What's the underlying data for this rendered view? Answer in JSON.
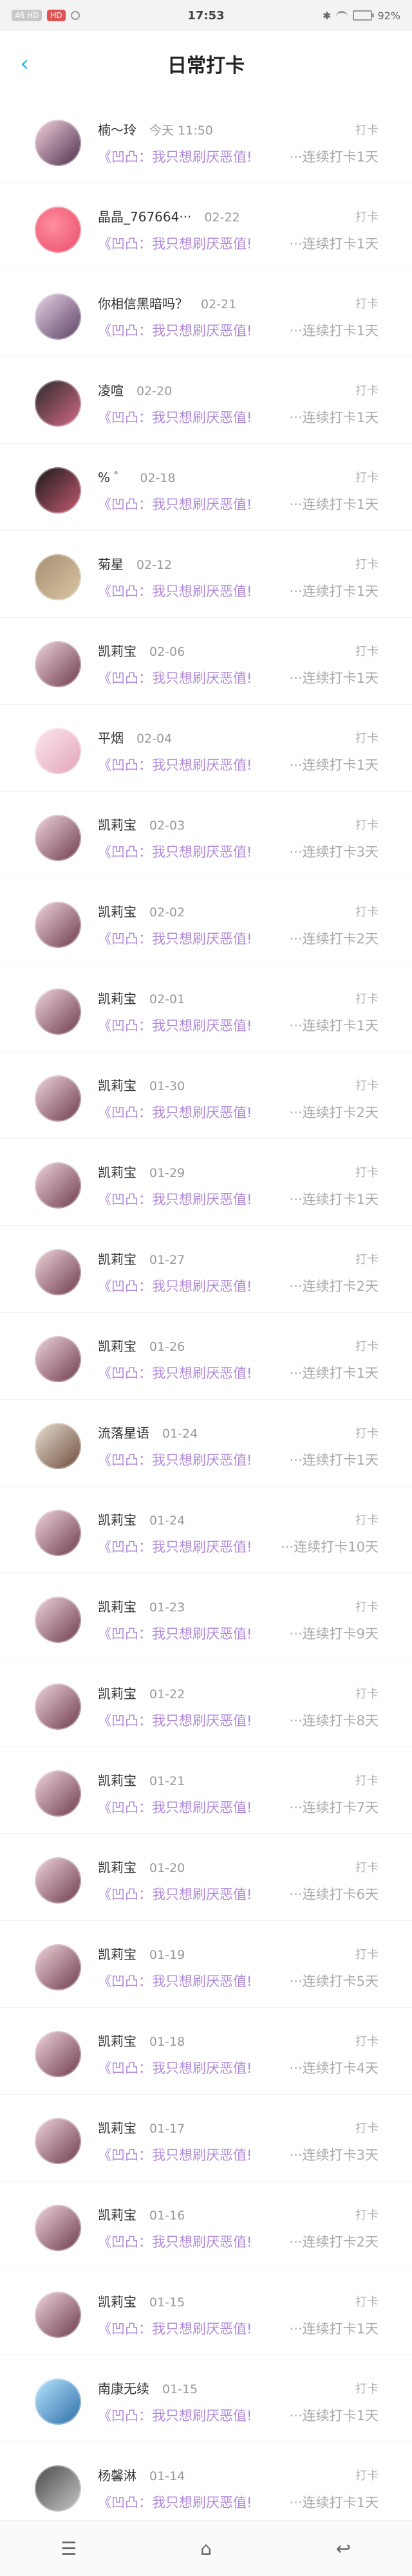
{
  "status_bar": {
    "time": "17:53",
    "left_labels": [
      "46 HD",
      "HD"
    ],
    "right_label": "92%"
  },
  "header": {
    "title": "日常打卡",
    "back_icon": "chevron-left-icon"
  },
  "rows": [
    {
      "name": "楠～玲",
      "date": "今天 11:50",
      "checkin": "打卡",
      "content": "《凹凸：我只想刷厌恶值!",
      "streak": "···连续打卡1天"
    },
    {
      "name": "晶晶_767664···",
      "date": "02-22",
      "checkin": "打卡",
      "content": "《凹凸：我只想刷厌恶值!",
      "streak": "···连续打卡1天"
    },
    {
      "name": "你相信黑暗吗？",
      "date": "02-21",
      "checkin": "打卡",
      "content": "《凹凸：我只想刷厌恶值!",
      "streak": "···连续打卡1天"
    },
    {
      "name": "凌喧",
      "date": "02-20",
      "checkin": "打卡",
      "content": "《凹凸：我只想刷厌恶值!",
      "streak": "···连续打卡1天"
    },
    {
      "name": "% ゜",
      "date": "02-18",
      "checkin": "打卡",
      "content": "《凹凸：我只想刷厌恶值!",
      "streak": "···连续打卡1天"
    },
    {
      "name": "菊星",
      "date": "02-12",
      "checkin": "打卡",
      "content": "《凹凸：我只想刷厌恶值!",
      "streak": "···连续打卡1天"
    },
    {
      "name": "凯莉宝",
      "date": "02-06",
      "checkin": "打卡",
      "content": "《凹凸：我只想刷厌恶值!",
      "streak": "···连续打卡1天"
    },
    {
      "name": "平烟",
      "date": "02-04",
      "checkin": "打卡",
      "content": "《凹凸：我只想刷厌恶值!",
      "streak": "···连续打卡1天"
    },
    {
      "name": "凯莉宝",
      "date": "02-03",
      "checkin": "打卡",
      "content": "《凹凸：我只想刷厌恶值!",
      "streak": "···连续打卡3天"
    },
    {
      "name": "凯莉宝",
      "date": "02-02",
      "checkin": "打卡",
      "content": "《凹凸：我只想刷厌恶值!",
      "streak": "···连续打卡2天"
    },
    {
      "name": "凯莉宝",
      "date": "02-01",
      "checkin": "打卡",
      "content": "《凹凸：我只想刷厌恶值!",
      "streak": "···连续打卡1天"
    },
    {
      "name": "凯莉宝",
      "date": "01-30",
      "checkin": "打卡",
      "content": "《凹凸：我只想刷厌恶值!",
      "streak": "···连续打卡2天"
    },
    {
      "name": "凯莉宝",
      "date": "01-29",
      "checkin": "打卡",
      "content": "《凹凸：我只想刷厌恶值!",
      "streak": "···连续打卡1天"
    },
    {
      "name": "凯莉宝",
      "date": "01-27",
      "checkin": "打卡",
      "content": "《凹凸：我只想刷厌恶值!",
      "streak": "···连续打卡2天"
    },
    {
      "name": "凯莉宝",
      "date": "01-26",
      "checkin": "打卡",
      "content": "《凹凸：我只想刷厌恶值!",
      "streak": "···连续打卡1天"
    },
    {
      "name": "流落星语",
      "date": "01-24",
      "checkin": "打卡",
      "content": "《凹凸：我只想刷厌恶值!",
      "streak": "···连续打卡1天"
    },
    {
      "name": "凯莉宝",
      "date": "01-24",
      "checkin": "打卡",
      "content": "《凹凸：我只想刷厌恶值!",
      "streak": "···连续打卡10天"
    },
    {
      "name": "凯莉宝",
      "date": "01-23",
      "checkin": "打卡",
      "content": "《凹凸：我只想刷厌恶值!",
      "streak": "···连续打卡9天"
    },
    {
      "name": "凯莉宝",
      "date": "01-22",
      "checkin": "打卡",
      "content": "《凹凸：我只想刷厌恶值!",
      "streak": "···连续打卡8天"
    },
    {
      "name": "凯莉宝",
      "date": "01-21",
      "checkin": "打卡",
      "content": "《凹凸：我只想刷厌恶值!",
      "streak": "···连续打卡7天"
    },
    {
      "name": "凯莉宝",
      "date": "01-20",
      "checkin": "打卡",
      "content": "《凹凸：我只想刷厌恶值!",
      "streak": "···连续打卡6天"
    },
    {
      "name": "凯莉宝",
      "date": "01-19",
      "checkin": "打卡",
      "content": "《凹凸：我只想刷厌恶值!",
      "streak": "···连续打卡5天"
    },
    {
      "name": "凯莉宝",
      "date": "01-18",
      "checkin": "打卡",
      "content": "《凹凸：我只想刷厌恶值!",
      "streak": "···连续打卡4天"
    },
    {
      "name": "凯莉宝",
      "date": "01-17",
      "checkin": "打卡",
      "content": "《凹凸：我只想刷厌恶值!",
      "streak": "···连续打卡3天"
    },
    {
      "name": "凯莉宝",
      "date": "01-16",
      "checkin": "打卡",
      "content": "《凹凸：我只想刷厌恶值!",
      "streak": "···连续打卡2天"
    },
    {
      "name": "凯莉宝",
      "date": "01-15",
      "checkin": "打卡",
      "content": "《凹凸：我只想刷厌恶值!",
      "streak": "···连续打卡1天"
    },
    {
      "name": "南康无续",
      "date": "01-15",
      "checkin": "打卡",
      "content": "《凹凸：我只想刷厌恶值!",
      "streak": "···连续打卡1天"
    },
    {
      "name": "杨馨淋",
      "date": "01-14",
      "checkin": "打卡",
      "content": "《凹凸：我只想刷厌恶值!",
      "streak": "···连续打卡1天"
    }
  ],
  "bottom_nav": {
    "menu_icon": "menu-icon",
    "home_icon": "home-icon",
    "back_icon": "back-icon"
  }
}
